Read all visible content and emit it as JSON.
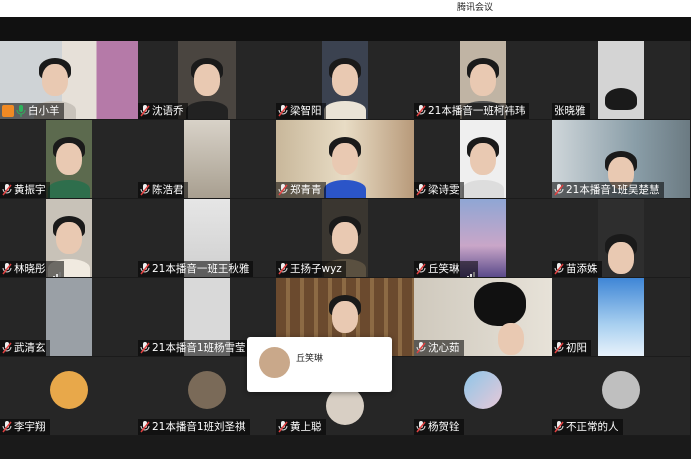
{
  "window": {
    "title": "腾讯会议"
  },
  "participants": [
    {
      "name": "白小羊",
      "host": true,
      "mic": "on"
    },
    {
      "name": "沈语乔",
      "mic": "off"
    },
    {
      "name": "梁智阳",
      "mic": "off"
    },
    {
      "name": "21本播音一班柯祎玮",
      "mic": "off"
    },
    {
      "name": "张晓雅",
      "mic": "none"
    },
    {
      "name": "黄振宇",
      "mic": "off"
    },
    {
      "name": "陈浩君",
      "mic": "off"
    },
    {
      "name": "郑青青",
      "mic": "off"
    },
    {
      "name": "梁诗雯",
      "mic": "off"
    },
    {
      "name": "21本播音1班吴楚慧",
      "mic": "off"
    },
    {
      "name": "林晓彤",
      "mic": "off",
      "signal": true
    },
    {
      "name": "21本播音一班王秋雅",
      "mic": "off"
    },
    {
      "name": "王扬子wyz",
      "mic": "off"
    },
    {
      "name": "丘笑琳",
      "mic": "off",
      "signal": true
    },
    {
      "name": "苗添姝",
      "mic": "off"
    },
    {
      "name": "武清玄",
      "mic": "off"
    },
    {
      "name": "21本播音1班杨雪莹",
      "mic": "off"
    },
    {
      "name": "",
      "mic": "none"
    },
    {
      "name": "沈心茹",
      "mic": "off"
    },
    {
      "name": "初阳",
      "mic": "off"
    },
    {
      "name": "李宇翔",
      "mic": "off"
    },
    {
      "name": "21本播音1班刘圣祺",
      "mic": "off"
    },
    {
      "name": "黄上聪",
      "mic": "off"
    },
    {
      "name": "杨贺铨",
      "mic": "off"
    },
    {
      "name": "不正常的人",
      "mic": "off"
    }
  ],
  "hover_card": {
    "name": "丘笑琳"
  },
  "colors": {
    "active_border": "#2db55d",
    "host_badge": "#f08a24",
    "mic_off": "#e04040"
  }
}
